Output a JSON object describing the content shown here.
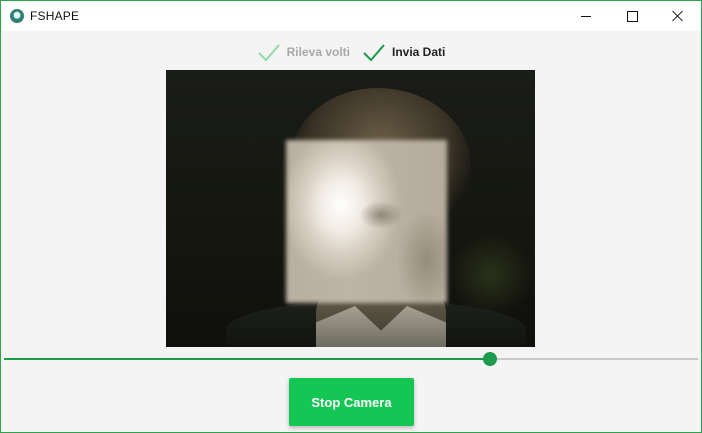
{
  "window": {
    "title": "FSHAPE",
    "icon": "app-logo-icon",
    "controls": [
      "minimize-icon",
      "maximize-icon",
      "close-icon"
    ]
  },
  "steps": [
    {
      "label": "Rileva volti",
      "state": "completed-inactive",
      "icon": "checkmark-icon",
      "color": "#8fdca8"
    },
    {
      "label": "Invia Dati",
      "state": "active",
      "icon": "checkmark-icon",
      "color": "#1e9a4d"
    }
  ],
  "camera": {
    "feed": "webcam-preview"
  },
  "slider": {
    "value": 0.7,
    "color": "#1e9a4d"
  },
  "actions": {
    "stop_label": "Stop Camera",
    "color": "#14c653"
  }
}
